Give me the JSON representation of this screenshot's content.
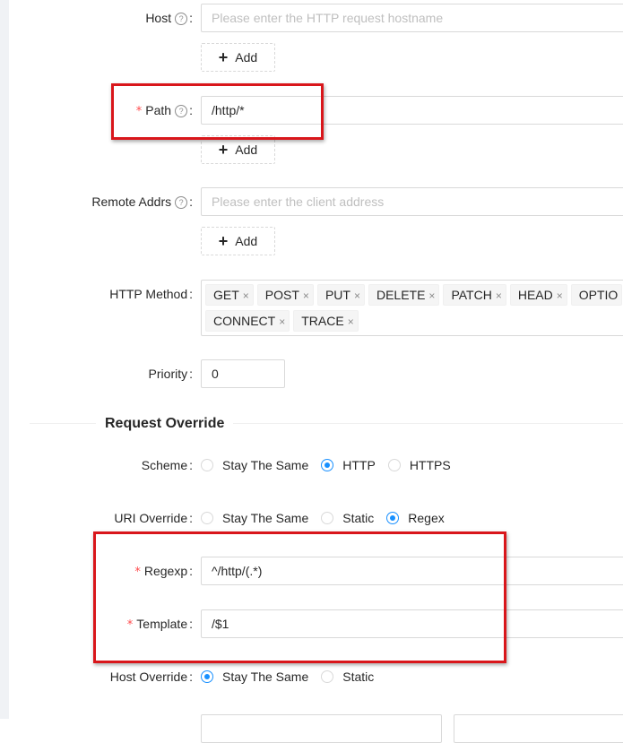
{
  "form": {
    "host": {
      "label": "Host",
      "placeholder": "Please enter the HTTP request hostname",
      "add_label": "Add"
    },
    "path": {
      "label": "Path",
      "value": "/http/*",
      "add_label": "Add"
    },
    "remote_addrs": {
      "label": "Remote Addrs",
      "placeholder": "Please enter the client address",
      "add_label": "Add"
    },
    "http_method": {
      "label": "HTTP Method",
      "tags": [
        "GET",
        "POST",
        "PUT",
        "DELETE",
        "PATCH",
        "HEAD",
        "OPTIO",
        "CONNECT",
        "TRACE"
      ]
    },
    "priority": {
      "label": "Priority",
      "value": "0"
    }
  },
  "request_override": {
    "title": "Request Override",
    "scheme": {
      "label": "Scheme",
      "options": [
        "Stay The Same",
        "HTTP",
        "HTTPS"
      ],
      "selected": "HTTP"
    },
    "uri_override": {
      "label": "URI Override",
      "options": [
        "Stay The Same",
        "Static",
        "Regex"
      ],
      "selected": "Regex"
    },
    "regexp": {
      "label": "Regexp",
      "value": "^/http/(.*)"
    },
    "template": {
      "label": "Template",
      "value": "/$1"
    },
    "host_override": {
      "label": "Host Override",
      "options": [
        "Stay The Same",
        "Static"
      ],
      "selected": "Stay The Same"
    }
  },
  "symbols": {
    "required": "*",
    "colon": ":",
    "help": "?",
    "plus": "+",
    "tag_close": "×"
  },
  "colors": {
    "primary": "#1890ff",
    "required": "#ff4d4f",
    "highlight_box": "#d9161b"
  }
}
